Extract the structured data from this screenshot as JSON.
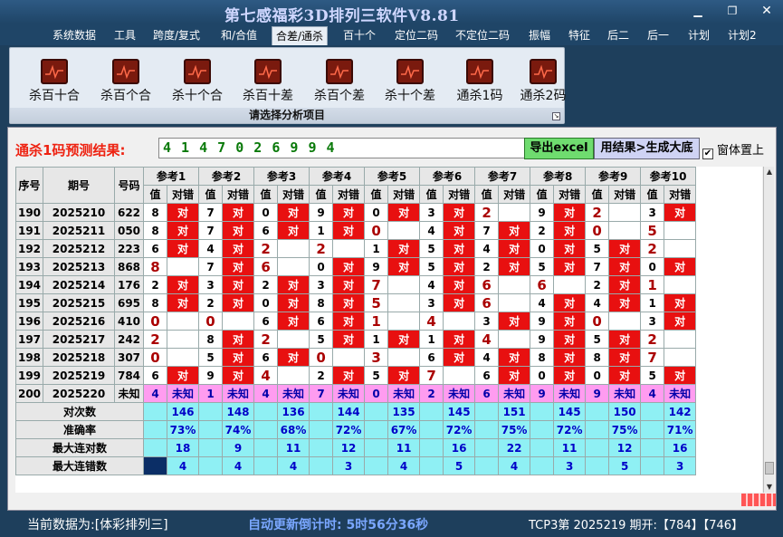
{
  "app": {
    "title": "第七感福彩3D排列三软件V8.81"
  },
  "menu": [
    "系统数据",
    "工具",
    "跨度/复式",
    "和/合值",
    "合差/通杀",
    "百十个",
    "定位二码",
    "不定位二码",
    "振幅",
    "特征",
    "后二",
    "后一",
    "计划",
    "计划2"
  ],
  "menu_active": 4,
  "ribbon": {
    "buttons": [
      "杀百十合",
      "杀百个合",
      "杀十个合",
      "杀百十差",
      "杀百个差",
      "杀十个差",
      "通杀1码",
      "通杀2码"
    ],
    "footer": "请选择分析项目"
  },
  "prediction": {
    "label": "通杀1码预测结果:",
    "value": "4 1 4 7 0 2 6 9 9 4",
    "export_button": "导出excel",
    "generate_button": "用结果>生成大底",
    "topmost_label": "窗体置上"
  },
  "table": {
    "head_seq": "序号",
    "head_period": "期号",
    "head_number": "号码",
    "refs": [
      "参考1",
      "参考2",
      "参考3",
      "参考4",
      "参考5",
      "参考6",
      "参考7",
      "参考8",
      "参考9",
      "参考10"
    ],
    "sub_val": "值",
    "sub_hit": "对错",
    "hit_text": "对",
    "unknown_text": "未知",
    "rows": [
      {
        "seq": "190",
        "period": "2025210",
        "number": "622",
        "vals": [
          "8",
          "7",
          "0",
          "9",
          "0",
          "3",
          "2",
          "9",
          "2",
          "3"
        ],
        "hits": [
          1,
          1,
          1,
          1,
          1,
          1,
          0,
          1,
          0,
          1
        ]
      },
      {
        "seq": "191",
        "period": "2025211",
        "number": "050",
        "vals": [
          "8",
          "7",
          "6",
          "1",
          "0",
          "4",
          "7",
          "2",
          "0",
          "5"
        ],
        "hits": [
          1,
          1,
          1,
          1,
          0,
          1,
          1,
          1,
          0,
          0
        ]
      },
      {
        "seq": "192",
        "period": "2025212",
        "number": "223",
        "vals": [
          "6",
          "4",
          "2",
          "2",
          "1",
          "5",
          "4",
          "0",
          "5",
          "2"
        ],
        "hits": [
          1,
          1,
          0,
          0,
          1,
          1,
          1,
          1,
          1,
          0
        ]
      },
      {
        "seq": "193",
        "period": "2025213",
        "number": "868",
        "vals": [
          "8",
          "7",
          "6",
          "0",
          "9",
          "5",
          "2",
          "5",
          "7",
          "0"
        ],
        "hits": [
          0,
          1,
          0,
          1,
          1,
          1,
          1,
          1,
          1,
          1
        ]
      },
      {
        "seq": "194",
        "period": "2025214",
        "number": "176",
        "vals": [
          "2",
          "3",
          "2",
          "3",
          "7",
          "4",
          "6",
          "6",
          "2",
          "1"
        ],
        "hits": [
          1,
          1,
          1,
          1,
          0,
          1,
          0,
          0,
          1,
          0
        ]
      },
      {
        "seq": "195",
        "period": "2025215",
        "number": "695",
        "vals": [
          "8",
          "2",
          "0",
          "8",
          "5",
          "3",
          "6",
          "4",
          "4",
          "1"
        ],
        "hits": [
          1,
          1,
          1,
          1,
          0,
          1,
          0,
          1,
          1,
          1
        ]
      },
      {
        "seq": "196",
        "period": "2025216",
        "number": "410",
        "vals": [
          "0",
          "0",
          "6",
          "6",
          "1",
          "4",
          "3",
          "9",
          "0",
          "3"
        ],
        "hits": [
          0,
          0,
          1,
          1,
          0,
          0,
          1,
          1,
          0,
          1
        ]
      },
      {
        "seq": "197",
        "period": "2025217",
        "number": "242",
        "vals": [
          "2",
          "8",
          "2",
          "5",
          "1",
          "1",
          "4",
          "9",
          "5",
          "2"
        ],
        "hits": [
          0,
          1,
          0,
          1,
          1,
          1,
          0,
          1,
          1,
          0
        ]
      },
      {
        "seq": "198",
        "period": "2025218",
        "number": "307",
        "vals": [
          "0",
          "5",
          "6",
          "0",
          "3",
          "6",
          "4",
          "8",
          "8",
          "7"
        ],
        "hits": [
          0,
          1,
          1,
          0,
          0,
          1,
          1,
          1,
          1,
          0
        ]
      },
      {
        "seq": "199",
        "period": "2025219",
        "number": "784",
        "vals": [
          "6",
          "9",
          "4",
          "2",
          "5",
          "7",
          "6",
          "0",
          "0",
          "5"
        ],
        "hits": [
          1,
          1,
          0,
          1,
          1,
          0,
          1,
          1,
          1,
          1
        ]
      },
      {
        "seq": "200",
        "period": "2025220",
        "number": "未知",
        "vals": [
          "4",
          "1",
          "4",
          "7",
          "0",
          "2",
          "6",
          "9",
          "9",
          "4"
        ],
        "hits": [
          2,
          2,
          2,
          2,
          2,
          2,
          2,
          2,
          2,
          2
        ]
      }
    ],
    "stats": [
      {
        "label": "对次数",
        "values": [
          "146",
          "148",
          "136",
          "144",
          "135",
          "145",
          "151",
          "145",
          "150",
          "142"
        ]
      },
      {
        "label": "准确率",
        "values": [
          "73%",
          "74%",
          "68%",
          "72%",
          "67%",
          "72%",
          "75%",
          "72%",
          "75%",
          "71%"
        ]
      },
      {
        "label": "最大连对数",
        "values": [
          "18",
          "9",
          "11",
          "12",
          "11",
          "16",
          "22",
          "11",
          "12",
          "16"
        ]
      },
      {
        "label": "最大连错数",
        "values": [
          "4",
          "4",
          "4",
          "3",
          "4",
          "5",
          "4",
          "3",
          "5",
          "3"
        ]
      }
    ]
  },
  "status": {
    "current": "当前数据为:[体彩排列三]",
    "countdown": "自动更新倒计时: 5时56分36秒",
    "draw": "TCP3第 2025219 期开:【784】【746】"
  }
}
